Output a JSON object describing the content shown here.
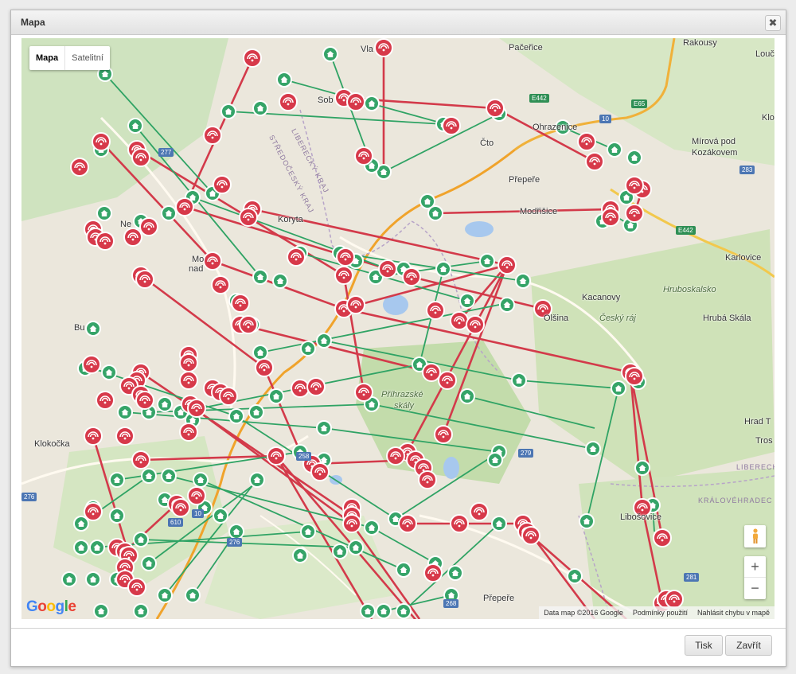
{
  "dialog": {
    "title": "Mapa",
    "close_glyph": "✖",
    "print_label": "Tisk",
    "close_label": "Zavřít"
  },
  "map": {
    "type_options": [
      "Mapa",
      "Satelitní"
    ],
    "selected_type": "Mapa",
    "zoom_in": "+",
    "zoom_out": "−",
    "attribution": {
      "data": "Data map ©2016 Google",
      "terms": "Podmínky použití",
      "report": "Nahlásit chybu v mapě"
    },
    "logo": [
      "G",
      "o",
      "o",
      "g",
      "l",
      "e"
    ],
    "places": {
      "pacerice": "Pačeřice",
      "rakousy": "Rakousy",
      "louc": "Louč",
      "vlastibor": "Vlastiboř",
      "ohrazenice": "Ohrazenice",
      "mirova": "Mírová pod",
      "kozakovem": "Kozákovem",
      "prepere1": "Přepeře",
      "modrisice": "Modřišice",
      "koryta": "Koryta",
      "kacanovy": "Kacanovy",
      "olsina": "Olšina",
      "hruboskalsko": "Hruboskalsko",
      "cesky_raj": "Český ráj",
      "hruba_skala": "Hrubá Skála",
      "karlovice": "Karlovice",
      "klokocka": "Klokočka",
      "prihrazske": "Příhrazské",
      "skaly": "skály",
      "hrad_trosky": "Hrad T",
      "trosky": "Tros",
      "libosovice": "Libošovice",
      "prepere2": "Přepeře",
      "sobotka": "Sob",
      "cto": "Čto",
      "mohelnice": "Mo",
      "nad": "nad",
      "ne": "Ne",
      "bu": "Bu",
      "kl": "Klo",
      "vla": "Vla"
    },
    "regions": {
      "liberecky": "LIBERECKÝ KRAJ",
      "stredocesky": "STŘEDOČESKÝ KRAJ",
      "liberecky2": "LIBERECK",
      "kralovehradecky": "KRÁLOVÉHRADEC"
    },
    "roads": {
      "r277": "277",
      "r268": "258",
      "r276": "276",
      "r276b": "276",
      "r610": "610",
      "r10": "10",
      "r10b": "10",
      "r279": "279",
      "r268b": "268",
      "r281": "281",
      "r283": "283",
      "e442": "E442",
      "e442b": "E442",
      "e65": "E65"
    },
    "colors": {
      "link_green": "#2fa364",
      "link_red": "#d33a4a",
      "node_green": "#35a468",
      "node_red": "#d7394a"
    }
  }
}
